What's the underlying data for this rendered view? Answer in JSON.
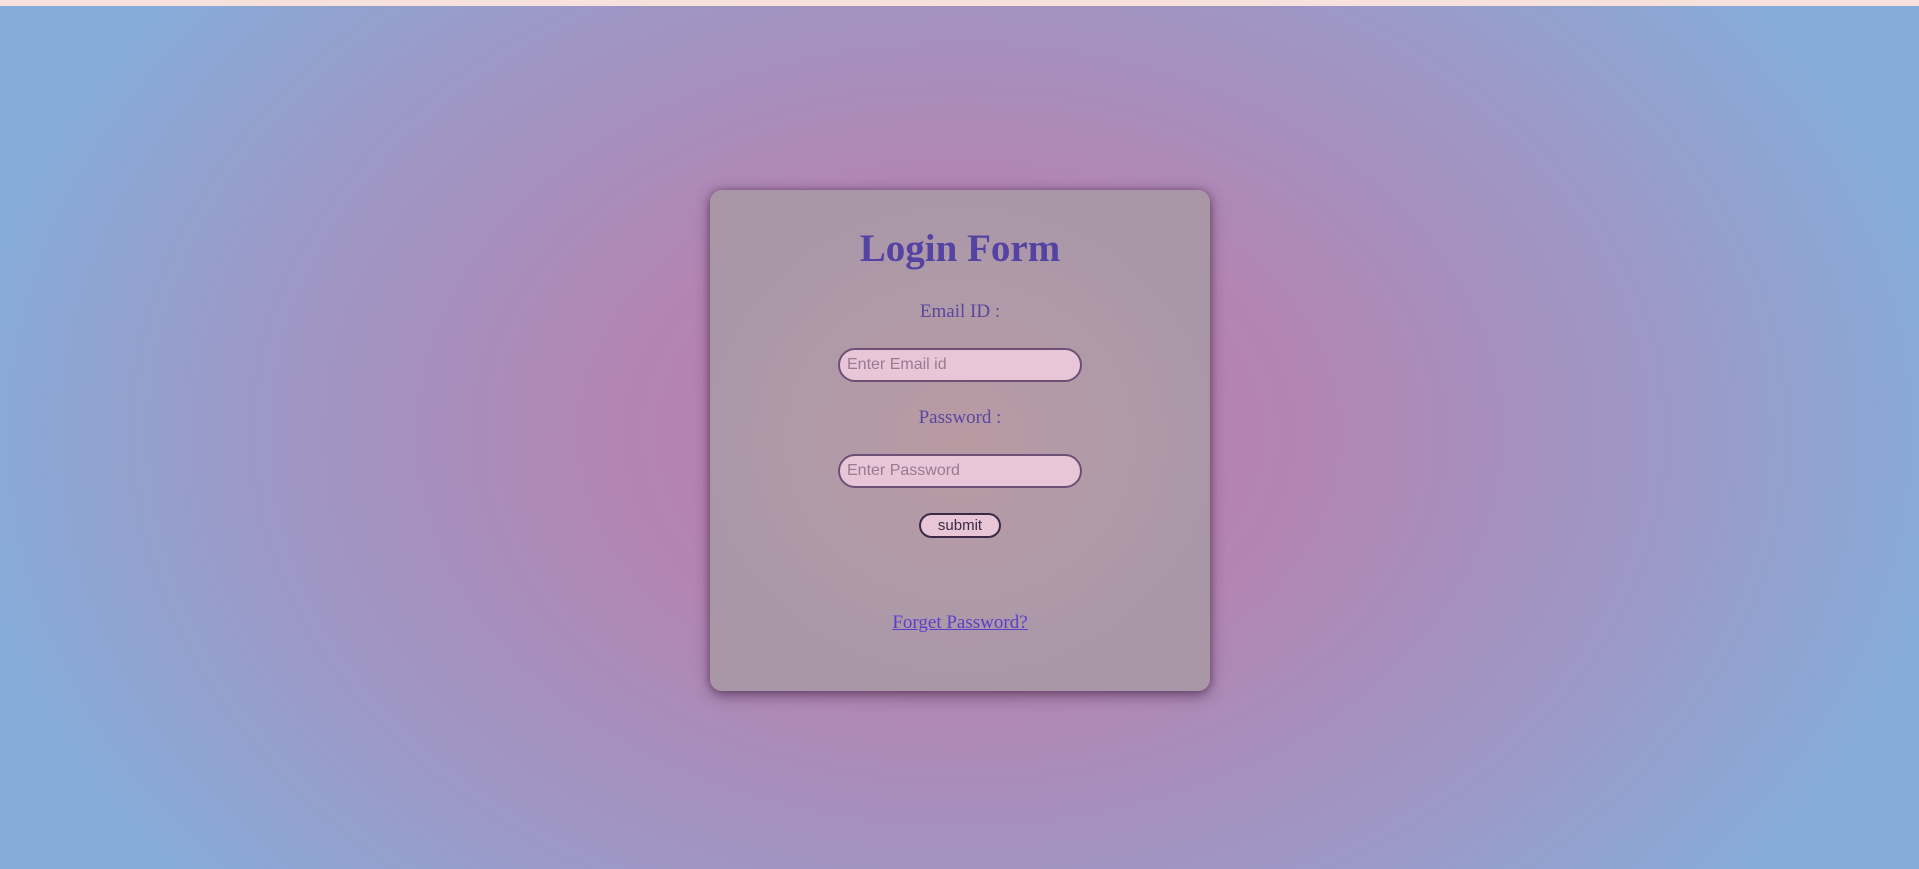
{
  "form": {
    "title": "Login Form",
    "email_label": "Email ID :",
    "email_placeholder": "Enter Email id",
    "email_value": "",
    "password_label": "Password :",
    "password_placeholder": "Enter Password",
    "password_value": "",
    "submit_label": "submit",
    "forget_link": "Forget Password?"
  },
  "colors": {
    "title": "#5443a3",
    "label": "#5a47a0",
    "link": "#5a3fc8",
    "input_background": "#e8c6d8",
    "background_center": "#c07aa6",
    "background_edge": "#86acd9"
  }
}
